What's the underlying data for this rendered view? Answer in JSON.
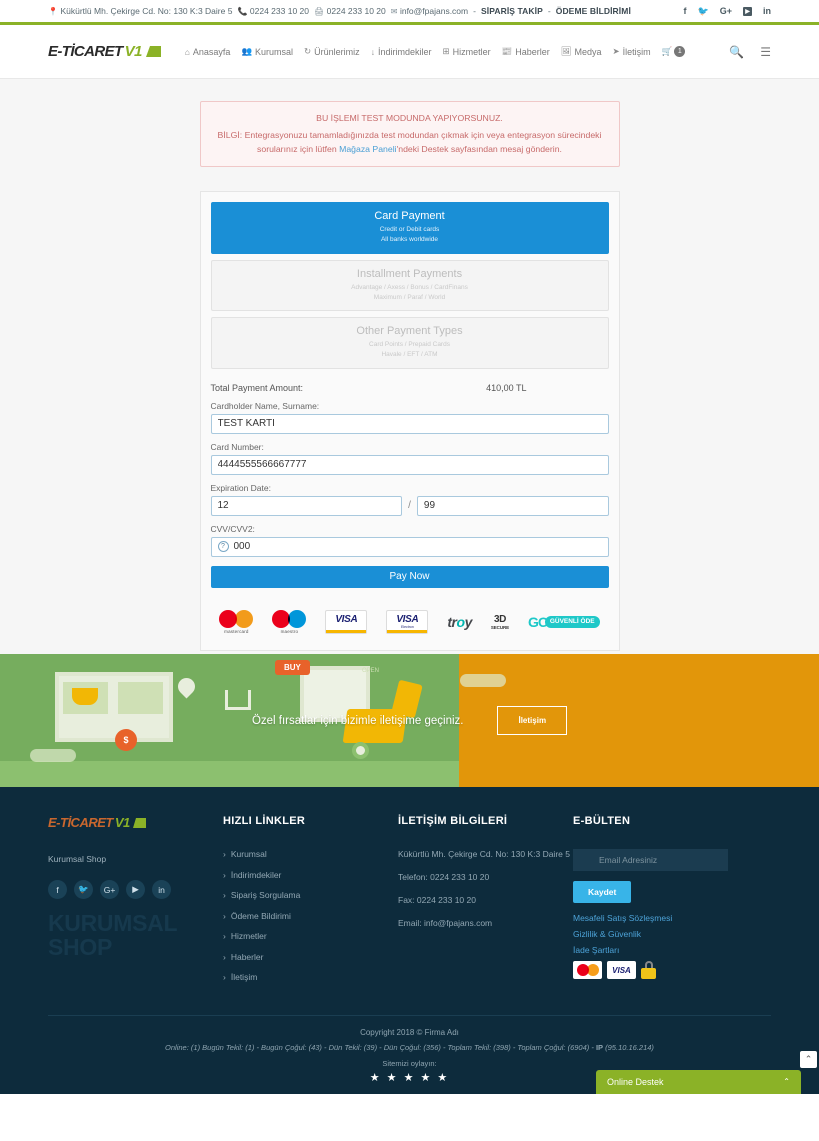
{
  "topbar": {
    "address": "Kükürtlü Mh. Çekirge Cd. No: 130 K:3 Daire 5",
    "phone": "0224 233 10 20",
    "fax": "0224 233 10 20",
    "email": "info@fpajans.com",
    "separator": "-",
    "link_order": "SİPARİŞ TAKİP",
    "link_payment": "ÖDEME BİLDİRİMİ",
    "socials": [
      "f",
      "t",
      "G+",
      "yt",
      "in"
    ]
  },
  "header": {
    "logo_part1": "E-TİCARET",
    "logo_part2": "V1",
    "nav": [
      {
        "label": "Anasayfa",
        "icon": "home-icon"
      },
      {
        "label": "Kurumsal",
        "icon": "users-icon"
      },
      {
        "label": "Ürünlerimiz",
        "icon": "refresh-icon"
      },
      {
        "label": "İndirimdekiler",
        "icon": "download-icon"
      },
      {
        "label": "Hizmetler",
        "icon": "grid-icon"
      },
      {
        "label": "Haberler",
        "icon": "news-icon"
      },
      {
        "label": "Medya",
        "icon": "image-icon"
      },
      {
        "label": "İletişim",
        "icon": "send-icon"
      }
    ],
    "cart_count": "1"
  },
  "alert": {
    "line1": "BU İŞLEMİ TEST MODUNDA YAPIYORSUNUZ.",
    "line2_a": "BİLGİ: Entegrasyonuzu tamamladığınızda test modundan çıkmak için veya entegrasyon sürecindeki sorularınız için lütfen ",
    "line2_link": "Mağaza Paneli",
    "line2_b": "'ndeki Destek sayfasından mesaj gönderin."
  },
  "payment_methods": [
    {
      "title": "Card Payment",
      "sub1": "Credit or Debit cards",
      "sub2": "All banks worldwide",
      "active": true
    },
    {
      "title": "Installment Payments",
      "sub1": "Advantage / Axess / Bonus / CardFinans",
      "sub2": "Maximum / Paraf / World",
      "active": false
    },
    {
      "title": "Other Payment Types",
      "sub1": "Card Points / Prepaid Cards",
      "sub2": "Havale / EFT / ATM",
      "active": false
    }
  ],
  "form": {
    "amount_label": "Total Payment Amount:",
    "amount_value": "410,00 TL",
    "name_label": "Cardholder Name, Surname:",
    "name_value": "TEST KARTI",
    "card_label": "Card Number:",
    "card_value": "4444555566667777",
    "exp_label": "Expiration Date:",
    "exp_month": "12",
    "exp_sep": "/",
    "exp_year": "99",
    "cvv_label": "CVV/CVV2:",
    "cvv_value": "000",
    "cvv_help": "?",
    "pay_button": "Pay Now"
  },
  "card_logos": {
    "mastercard": "mastercard",
    "maestro": "maestro",
    "visa": "VISA",
    "visa_electron": "VISA",
    "visa_electron_sub": "Electron",
    "troy_a": "tr",
    "troy_b": "o",
    "troy_c": "y",
    "secure_a": "3D",
    "secure_b": "SECURE",
    "go": "GO",
    "go_text": "GÜVENLİ ÖDE"
  },
  "cta": {
    "text": "Özel fırsatlar için bizimle iletişime geçiniz.",
    "button": "İletişim",
    "buy_badge": "BUY",
    "open_badge": "OPEN",
    "coin": "$"
  },
  "footer": {
    "logo_part1": "E-TİCARET",
    "logo_part2": "V1",
    "tagline": "Kurumsal Shop",
    "watermark_l1": "KURUMSAL",
    "watermark_l2": "SHOP",
    "socials": [
      "f",
      "t",
      "G+",
      "yt",
      "in"
    ],
    "quicklinks_head": "HIZLI LİNKLER",
    "quicklinks": [
      "Kurumsal",
      "İndirimdekiler",
      "Sipariş Sorgulama",
      "Ödeme Bildirimi",
      "Hizmetler",
      "Haberler",
      "İletişim"
    ],
    "contact_head": "İLETİŞİM BİLGİLERİ",
    "contact": [
      "Kükürtlü Mh. Çekirge Cd. No: 130 K:3 Daire 5",
      "Telefon: 0224 233 10 20",
      "Fax: 0224 233 10 20",
      "Email: info@fpajans.com"
    ],
    "newsletter_head": "E-BÜLTEN",
    "newsletter_placeholder": "Email Adresiniz",
    "newsletter_button": "Kaydet",
    "legal_links": [
      "Mesafeli Satış Sözleşmesi",
      "Gizlilik & Güvenlik",
      "İade Şartları"
    ],
    "fcard_mc": "MasterCard",
    "fcard_visa": "VISA"
  },
  "bottom": {
    "copyright": "Copyright 2018 © Firma Adı",
    "stats_prefix": "Online: (1)  Bugün Tekil: (1) -  Bugün Çoğul: (43) - Dün Tekil: (39) -  Dün Çoğul: (356) -  Toplam Tekil: (398) -  Toplam Çoğul: (6904) - ",
    "stats_ip_label": "IP",
    "stats_ip": "(95.10.16.214)",
    "rate_label": "Sitemizi oylayın:",
    "stars": "★ ★ ★ ★ ★"
  },
  "support": {
    "label": "Online Destek",
    "chevron": "⌃",
    "totop": "⌃"
  }
}
